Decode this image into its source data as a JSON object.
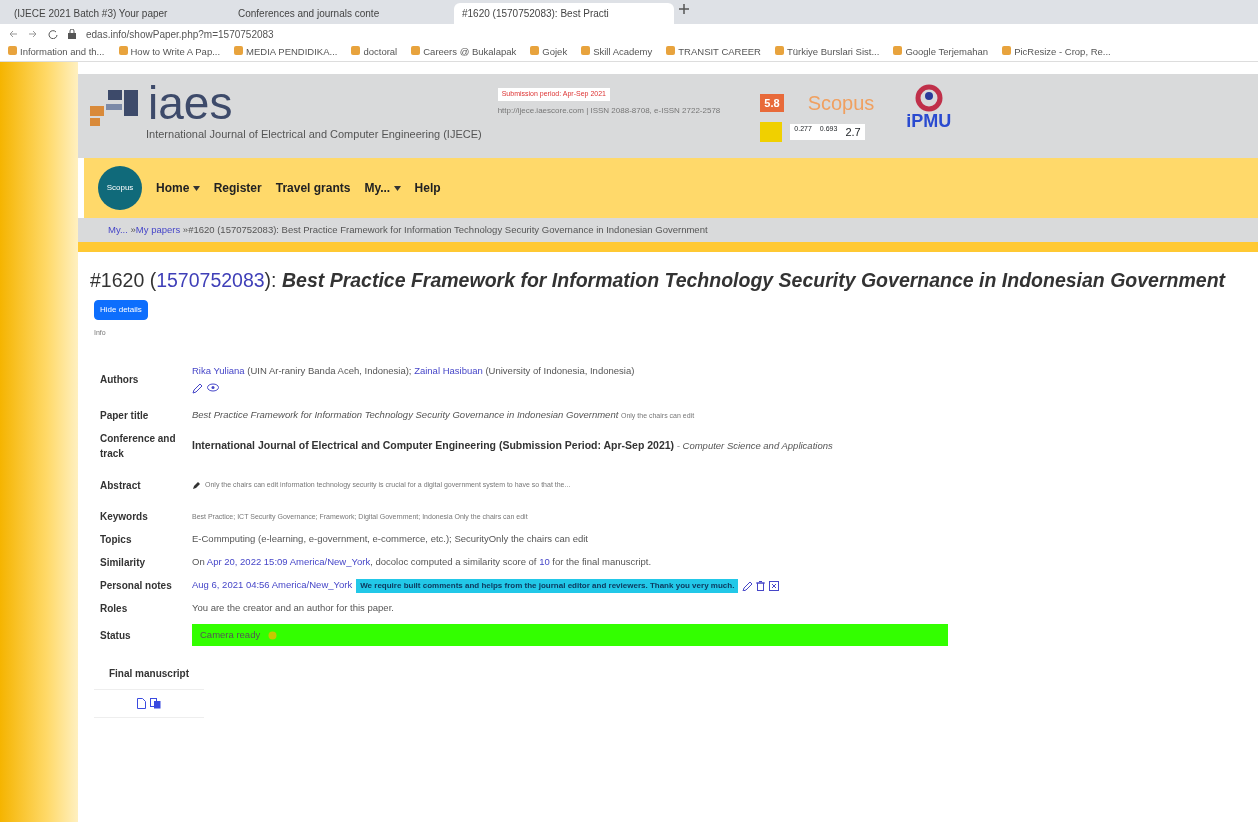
{
  "browser": {
    "tabs": [
      {
        "label": "(IJECE 2021 Batch #3) Your paper",
        "selected": false
      },
      {
        "label": "Conferences and journals conte",
        "selected": false
      },
      {
        "label": "#1620 (1570752083): Best Practi",
        "selected": true
      }
    ],
    "url": "edas.info/showPaper.php?m=1570752083",
    "bookmarks": [
      "Information and th...",
      "How to Write A Pap...",
      "MEDIA PENDIDIKA...",
      "doctoral",
      "Careers @ Bukalapak",
      "Gojek",
      "Skill Academy",
      "TRANSIT CAREER",
      "Türkiye Burslari Sist...",
      "Google Terjemahan",
      "PicResize - Crop, Re..."
    ]
  },
  "header": {
    "logo": "iaes",
    "submission_badge": "Submission period: Apr-Sep 2021",
    "issn": "http://ijece.iaescore.com | ISSN 2088-8708, e-ISSN 2722-2578",
    "journal": "International Journal of Electrical and Computer Engineering (IJECE)",
    "sjr": "5.8",
    "scopus": "Scopus",
    "metrics": [
      "0.277",
      "0.693",
      "2.7"
    ],
    "ipmu": "iPMU",
    "scopus_badge": "Scopus"
  },
  "nav": [
    {
      "label": "Home",
      "dropdown": true
    },
    {
      "label": "Register",
      "dropdown": false
    },
    {
      "label": "Travel grants",
      "dropdown": false
    },
    {
      "label": "My...",
      "dropdown": true
    },
    {
      "label": "Help",
      "dropdown": false
    }
  ],
  "breadcrumb_separator": "»",
  "breadcrumb": [
    {
      "label": "My...",
      "link": true
    },
    {
      "label": "My papers",
      "link": true
    },
    {
      "label": "#1620 (1570752083): Best Practice Framework for Information Technology Security Governance in Indonesian Government",
      "link": false
    }
  ],
  "paper": {
    "number": "#1620",
    "open": "(",
    "close": "):",
    "id": "1570752083",
    "title": "Best Practice Framework for Information Technology Security Governance in Indonesian Government",
    "hide_button": "Hide details",
    "note": "Info"
  },
  "details": [
    {
      "kind": "authors",
      "label": "Authors",
      "authors": [
        {
          "name": "Rika Yuliana",
          "affiliation": "(UIN Ar-raniry Banda Aceh, Indonesia);"
        },
        {
          "name": "Zainal Hasibuan",
          "affiliation": "(University of Indonesia, Indonesia)"
        }
      ]
    },
    {
      "kind": "title",
      "label": "Paper title",
      "value": "Best Practice Framework for Information Technology Security Governance in Indonesian Government",
      "hint": "Only the chairs can edit"
    },
    {
      "kind": "track",
      "label": "Conference and track",
      "value": "International Journal of Electrical and Computer Engineering (Submission Period: Apr-Sep 2021)",
      "track": "- Computer Science and Applications"
    },
    {
      "kind": "abstract",
      "label": "Abstract",
      "value": "Only the chairs can edit information technology security is crucial for a digital government system to have so that the..."
    },
    {
      "kind": "small",
      "label": "Keywords",
      "value": "Best Practice; ICT Security Governance; Framework; Digital Government; Indonesia Only the chairs can edit"
    },
    {
      "kind": "plain",
      "label": "Topics",
      "value": "E-Commputing (e-learning, e-government, e-commerce, etc.); SecurityOnly the chairs can edit"
    },
    {
      "kind": "similarity",
      "label": "Similarity",
      "pre": "On",
      "date": "Apr 20, 2022 15:09 America/New_York",
      "post": ", docoloc computed a similarity score of",
      "score": "10",
      "end": "for the final manuscript."
    },
    {
      "kind": "notes",
      "label": "Personal notes",
      "date": "Aug 6, 2021 04:56 America/New_York",
      "note": "We require built comments and helps from the journal editor and reviewers. Thank you very much."
    },
    {
      "kind": "plain",
      "label": "Roles",
      "value": "You are the creator and an author for this paper."
    },
    {
      "kind": "status",
      "label": "Status",
      "value": "Camera ready",
      "color": "#33ff00"
    }
  ],
  "final_manuscript": "Final manuscript"
}
